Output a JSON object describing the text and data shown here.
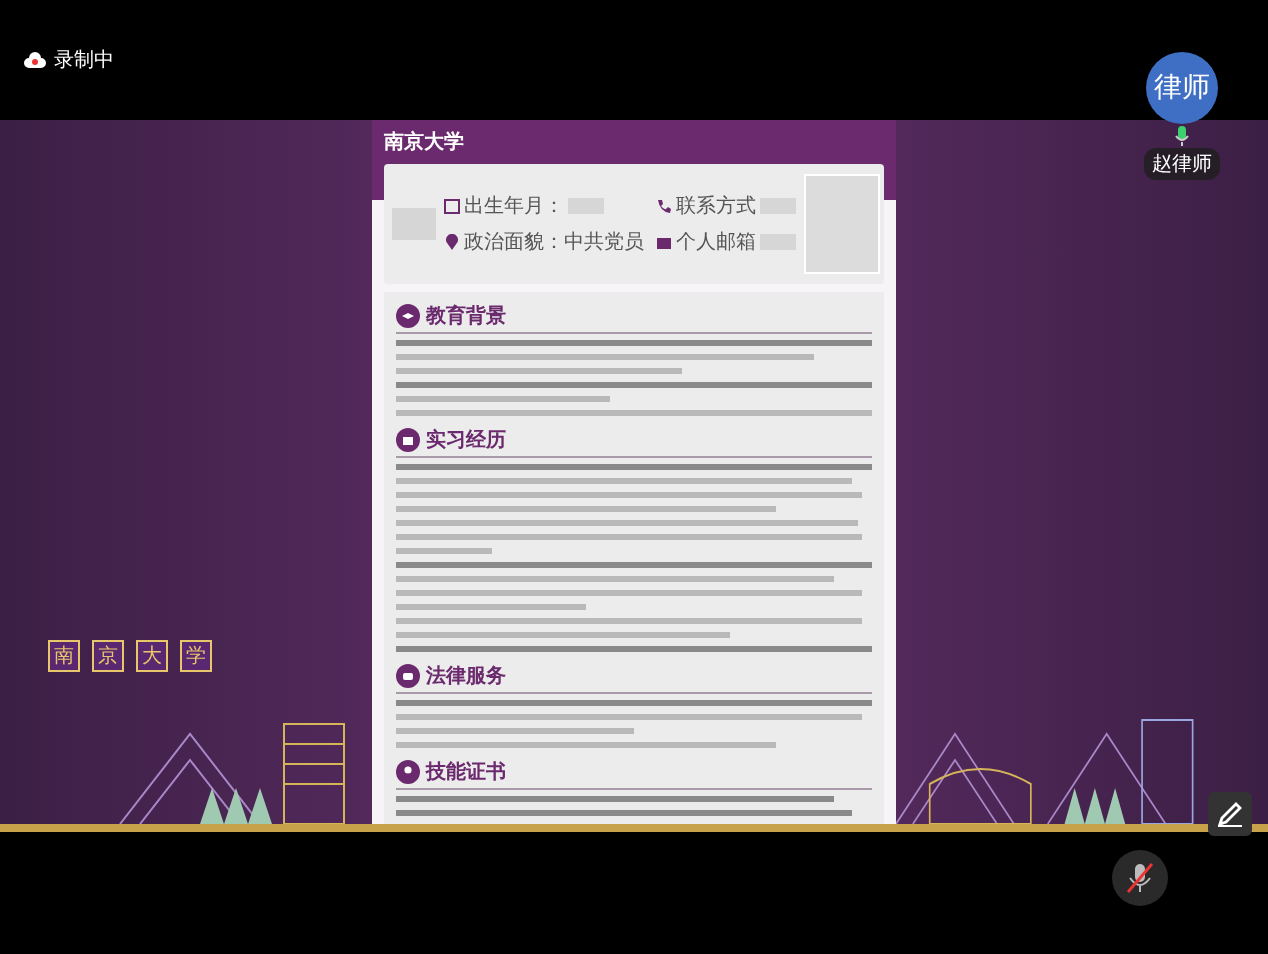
{
  "recording": {
    "label": "录制中"
  },
  "participant": {
    "avatar_text": "律师",
    "name": "赵律师",
    "mic_on": true
  },
  "shared_document": {
    "logo": "南京大学",
    "contact": [
      {
        "kind": "birth",
        "label": "出生年月："
      },
      {
        "kind": "phone",
        "label": "联系方式"
      },
      {
        "kind": "politics",
        "label": "政治面貌：中共党员"
      },
      {
        "kind": "email",
        "label": "个人邮箱"
      }
    ],
    "sections": [
      {
        "kind": "education",
        "title": "教育背景"
      },
      {
        "kind": "internship",
        "title": "实习经历"
      },
      {
        "kind": "legal_service",
        "title": "法律服务"
      },
      {
        "kind": "skills",
        "title": "技能证书"
      }
    ],
    "footer_seal": [
      "南",
      "京",
      "大",
      "学"
    ]
  },
  "controls": {
    "self_mic_muted": true
  }
}
